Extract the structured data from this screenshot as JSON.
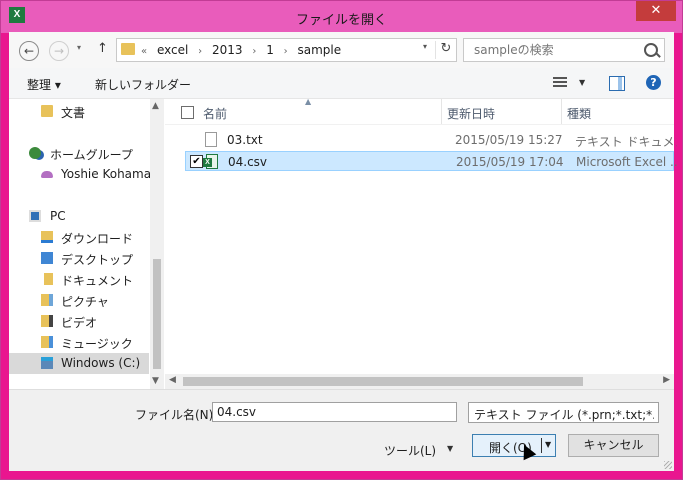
{
  "window": {
    "title": "ファイルを開く",
    "app_icon": "excel-icon",
    "close_glyph": "✕"
  },
  "address": {
    "back_glyph": "←",
    "forward_glyph": "→",
    "up_glyph": "↑",
    "crumb_lead": "«",
    "crumbs": [
      "excel",
      "2013",
      "1",
      "sample"
    ],
    "separator": "›",
    "refresh_glyph": "↻",
    "search_placeholder": "sampleの検索"
  },
  "toolbar": {
    "organize": "整理 ▾",
    "new_folder": "新しいフォルダー",
    "help_glyph": "?"
  },
  "nav": {
    "items": [
      {
        "label": "文書",
        "icon": "folder-icon"
      },
      {
        "label": "ホームグループ",
        "icon": "homegroup-icon"
      },
      {
        "label": "Yoshie Kohama",
        "icon": "user-icon"
      },
      {
        "label": "PC",
        "icon": "pc-icon"
      },
      {
        "label": "ダウンロード",
        "icon": "downloads-folder-icon"
      },
      {
        "label": "デスクトップ",
        "icon": "desktop-folder-icon"
      },
      {
        "label": "ドキュメント",
        "icon": "documents-folder-icon"
      },
      {
        "label": "ピクチャ",
        "icon": "pictures-folder-icon"
      },
      {
        "label": "ビデオ",
        "icon": "videos-folder-icon"
      },
      {
        "label": "ミュージック",
        "icon": "music-folder-icon"
      },
      {
        "label": "Windows (C:)",
        "icon": "drive-icon"
      }
    ]
  },
  "files": {
    "headers": {
      "name": "名前",
      "date": "更新日時",
      "type": "種類"
    },
    "rows": [
      {
        "name": "03.txt",
        "date": "2015/05/19 15:27",
        "type": "テキスト ドキュメント",
        "icon": "text-file-icon",
        "selected": false
      },
      {
        "name": "04.csv",
        "date": "2015/05/19 17:04",
        "type": "Microsoft Excel ...",
        "icon": "excel-csv-icon",
        "selected": true
      }
    ]
  },
  "bottom": {
    "filename_label": "ファイル名(N):",
    "filename_value": "04.csv",
    "filetype_value": "テキスト ファイル (*.prn;*.txt;*.csv)",
    "tools": "ツール(L)",
    "open": "開く(O)",
    "cancel": "キャンセル"
  },
  "colors": {
    "title_bar": "#e95cbb",
    "frame": "#e9168f",
    "selection": "#cce8ff",
    "close_button": "#c43c3c"
  }
}
